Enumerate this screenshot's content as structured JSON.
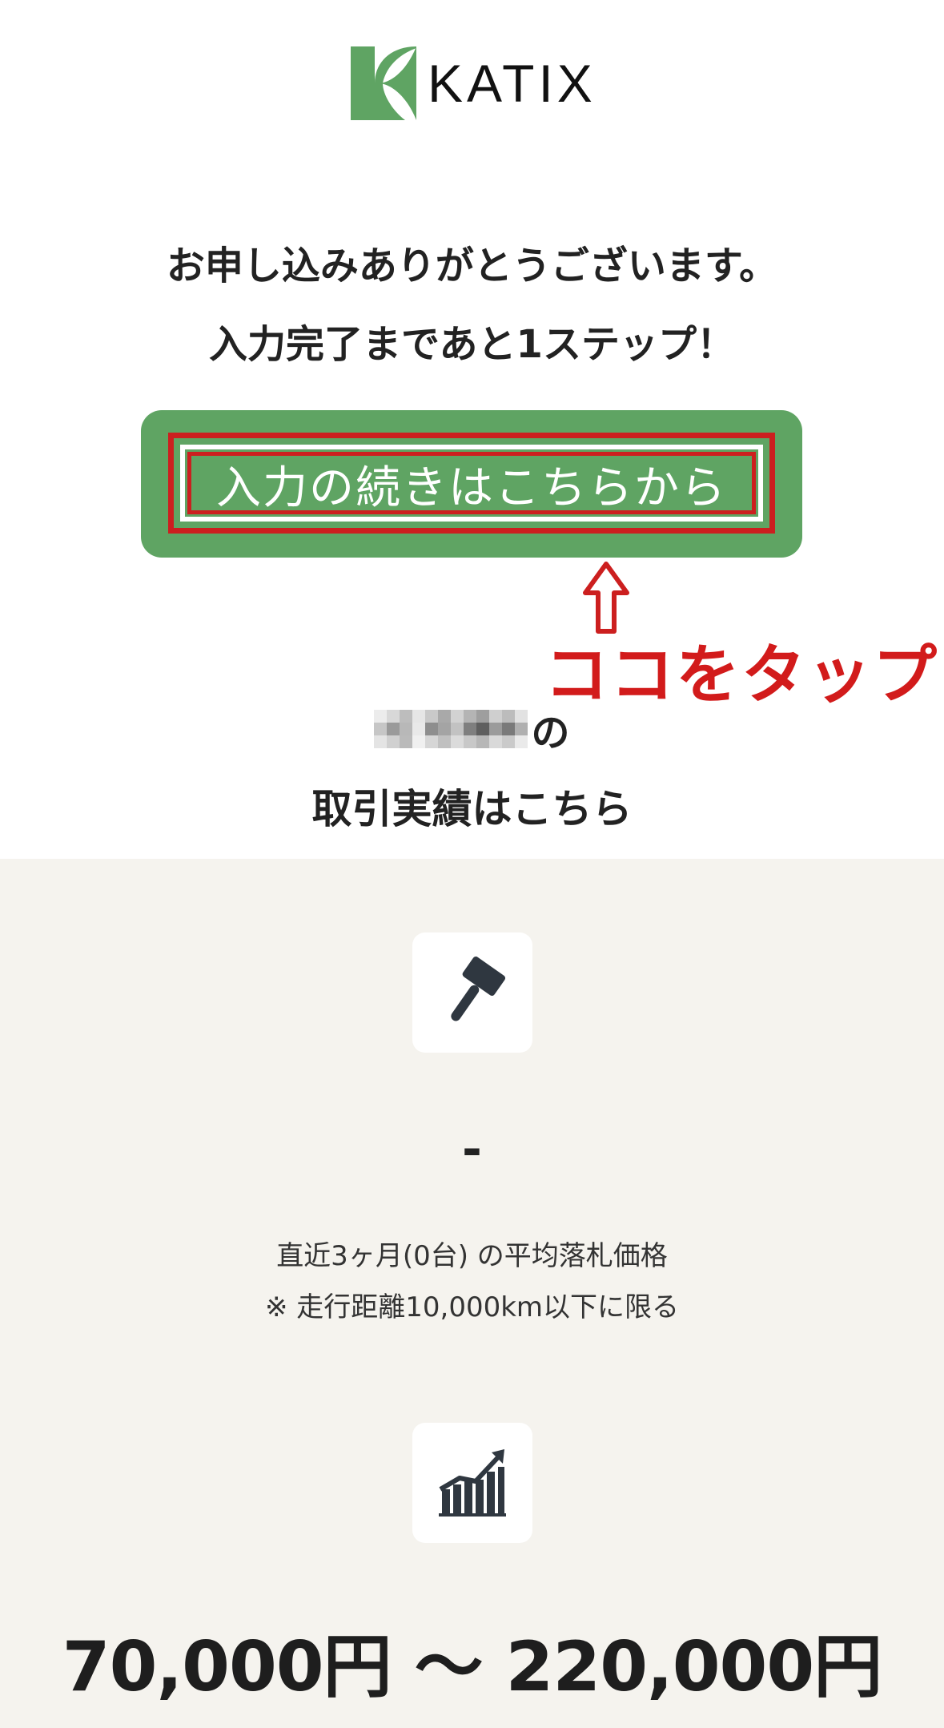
{
  "brand": {
    "name": "KATIX",
    "mark_color": "#5fa463"
  },
  "headline": {
    "line1": "お申し込みありがとうございます。",
    "line2": "入力完了まであと1ステップ！"
  },
  "cta": {
    "label": "入力の続きはこちらから",
    "color": "#5fa463",
    "highlight_color": "#cc1f1f"
  },
  "annotation": {
    "arrow": "⇧",
    "text": "ココをタップ",
    "color": "#d21b1b"
  },
  "owner": {
    "suffix": "の"
  },
  "results": {
    "title": "取引実績はこちら"
  },
  "stats": [
    {
      "icon": "gavel-icon",
      "value": "-",
      "caption": "直近3ヶ月(0台) の平均落札価格",
      "note": "※ 走行距離10,000km以下に限る"
    },
    {
      "icon": "trend-chart-icon",
      "value": "70,000円 〜 220,000円"
    }
  ],
  "colors": {
    "section_bg": "#f5f3ee",
    "icon_color": "#2f3740"
  }
}
